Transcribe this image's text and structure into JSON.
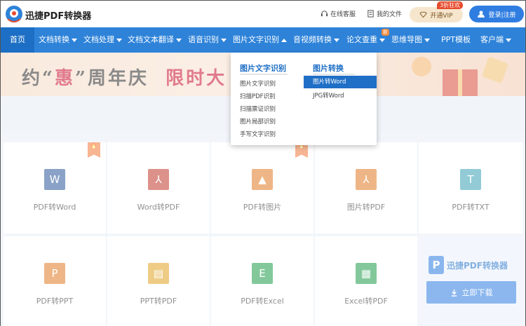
{
  "header": {
    "brand": "迅捷PDF转换器",
    "service": "在线客服",
    "my_files": "我的文件",
    "vip_label": "开通VIP",
    "vip_badge": "3折狂欢",
    "login": "登录|注册"
  },
  "nav": {
    "items": [
      {
        "label": "首页"
      },
      {
        "label": "文档转换"
      },
      {
        "label": "文档处理"
      },
      {
        "label": "文档文本翻译"
      },
      {
        "label": "语音识别"
      },
      {
        "label": "图片文字识别"
      },
      {
        "label": "音视频转换"
      },
      {
        "label": "论文查重"
      },
      {
        "label": "思维导图"
      },
      {
        "label": "PPT模板"
      },
      {
        "label": "客户端"
      }
    ],
    "new_badge": "新"
  },
  "banner": {
    "part1": "约“",
    "part2": "惠",
    "part3": "”周年庆",
    "part4": "限时大"
  },
  "dropdown": {
    "col1_title": "图片文字识别",
    "col1_items": [
      "图片文字识别",
      "扫描PDF识别",
      "扫描票证识别",
      "图片局部识别",
      "手写文字识别"
    ],
    "col2_title": "图片转换",
    "col2_items": [
      "图片转Word",
      "JPG转Word"
    ]
  },
  "tools_row1": [
    {
      "label": "PDF转Word",
      "letter": "W",
      "color": "#2b579a"
    },
    {
      "label": "Word转PDF",
      "letter": "⅄",
      "color": "#c0392b"
    },
    {
      "label": "PDF转图片",
      "letter": "▲",
      "color": "#e07b24"
    },
    {
      "label": "图片转PDF",
      "letter": "⅄",
      "color": "#e07b24"
    },
    {
      "label": "PDF转TXT",
      "letter": "T",
      "color": "#3aa0b5"
    }
  ],
  "tools_row2": [
    {
      "label": "PDF转PPT",
      "letter": "P",
      "color": "#e07b24"
    },
    {
      "label": "PPT转PDF",
      "letter": "▤",
      "color": "#e0a324"
    },
    {
      "label": "PDF转Excel",
      "letter": "E",
      "color": "#1e9c48"
    },
    {
      "label": "Excel转PDF",
      "letter": "▦",
      "color": "#1e9c48"
    }
  ],
  "promo": {
    "title": "迅捷PDF转换器",
    "logo": "P",
    "download": "立即下载"
  }
}
